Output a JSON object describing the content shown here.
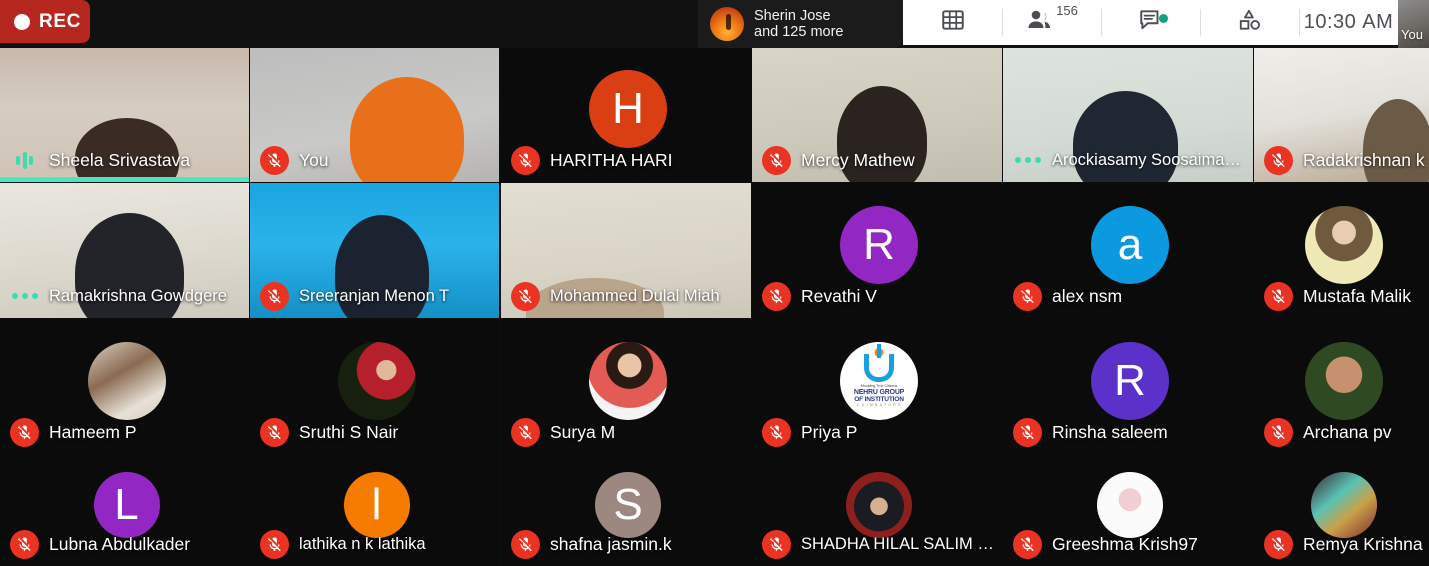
{
  "topbar": {
    "recording_label": "REC",
    "recording_color": "#b5271f",
    "active_speaker_name": "Sherin Jose",
    "active_speaker_more": "and 125 more",
    "layout_icon": "grid-layout-icon",
    "people_icon": "people-icon",
    "participant_count": "156",
    "chat_icon": "chat-icon",
    "chat_has_unread": true,
    "reactions_icon": "shapes-reactions-icon",
    "time": "10:30",
    "time_meridiem": "AM",
    "selfview_label": "You",
    "accent_green": "#0fa47f"
  },
  "grid": {
    "speaking_border_color": "#4ae8c0",
    "mic_muted_color": "#ea3323",
    "audio_active_color": "#3ddcb0",
    "participants": [
      {
        "name": "Sheela Srivastava",
        "audio": "speaking",
        "media": "video",
        "speaking": true
      },
      {
        "name": "You",
        "audio": "muted",
        "media": "video"
      },
      {
        "name": "HARITHA HARI",
        "audio": "muted",
        "media": "initial",
        "initial": "H",
        "color": "#d93f13"
      },
      {
        "name": "Mercy Mathew",
        "audio": "muted",
        "media": "video"
      },
      {
        "name": "Arockiasamy Soosaima…",
        "audio": "idle-dots",
        "media": "video"
      },
      {
        "name": "Radakrishnan k",
        "audio": "muted",
        "media": "video"
      },
      {
        "name": "Ramakrishna Gowdgere",
        "audio": "idle-dots",
        "media": "video"
      },
      {
        "name": "Sreeranjan Menon T",
        "audio": "muted",
        "media": "video"
      },
      {
        "name": "Mohammed Dulal Miah",
        "audio": "muted",
        "media": "video"
      },
      {
        "name": "Revathi V",
        "audio": "muted",
        "media": "initial",
        "initial": "R",
        "color": "#9327c4"
      },
      {
        "name": "alex nsm",
        "audio": "muted",
        "media": "initial",
        "initial": "a",
        "color": "#0b9ae0"
      },
      {
        "name": "Mustafa Malik",
        "audio": "muted",
        "media": "photo"
      },
      {
        "name": "Hameem P",
        "audio": "muted",
        "media": "photo"
      },
      {
        "name": "Sruthi S Nair",
        "audio": "muted",
        "media": "photo"
      },
      {
        "name": "Surya M",
        "audio": "muted",
        "media": "photo"
      },
      {
        "name": "Priya P",
        "audio": "muted",
        "media": "logo",
        "logo_tagline": "Moulding True Citizens",
        "logo_line1": "NEHRU GROUP",
        "logo_line2": "OF INSTITUTION",
        "logo_line3": "C O I M B A T O R E"
      },
      {
        "name": "Rinsha saleem",
        "audio": "muted",
        "media": "initial",
        "initial": "R",
        "color": "#5b31c9"
      },
      {
        "name": "Archana pv",
        "audio": "muted",
        "media": "photo"
      },
      {
        "name": "Lubna Abdulkader",
        "audio": "muted",
        "media": "initial",
        "initial": "L",
        "color": "#9327c4"
      },
      {
        "name": "lathika n k lathika",
        "audio": "muted",
        "media": "initial",
        "initial": "l",
        "color": "#f57c00"
      },
      {
        "name": "shafna jasmin.k",
        "audio": "muted",
        "media": "initial",
        "initial": "S",
        "color": "#9c8880"
      },
      {
        "name": "SHADHA HILAL SALIM …",
        "audio": "muted",
        "media": "photo"
      },
      {
        "name": "Greeshma Krish97",
        "audio": "muted",
        "media": "photo"
      },
      {
        "name": "Remya Krishna",
        "audio": "muted",
        "media": "photo"
      }
    ]
  }
}
